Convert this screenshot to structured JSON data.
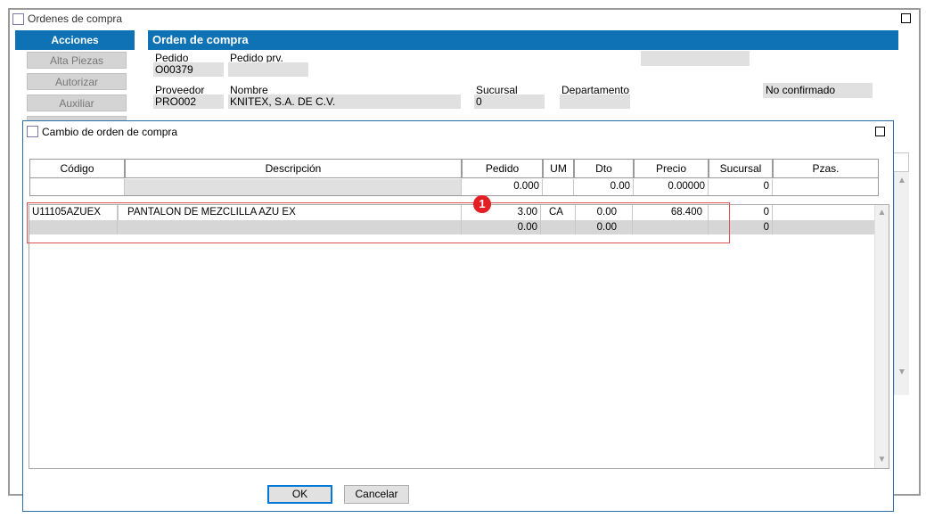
{
  "back_window": {
    "title": "Ordenes de compra",
    "actions_header": "Acciones",
    "side_buttons": [
      "Alta Piezas",
      "Autorizar",
      "Auxiliar"
    ],
    "section_header": "Orden de compra",
    "fields": {
      "pedido_label": "Pedido",
      "pedido_value": "O00379",
      "pedido_prv_label": "Pedido prv.",
      "pedido_prv_value": "",
      "proveedor_label": "Proveedor",
      "proveedor_value": "PRO002",
      "nombre_label": "Nombre",
      "nombre_value": "KNITEX, S.A. DE C.V.",
      "sucursal_label": "Sucursal",
      "sucursal_value": "0",
      "departamento_label": "Departamento",
      "departamento_value": "",
      "status_value": "No confirmado"
    }
  },
  "dialog": {
    "title": "Cambio de orden de compra",
    "columns": [
      "Código",
      "Descripción",
      "Pedido",
      "UM",
      "Dto",
      "Precio",
      "Sucursal",
      "Pzas."
    ],
    "entry_row": {
      "codigo": "",
      "descripcion": "",
      "pedido": "0.000",
      "um": "",
      "dto": "0.00",
      "precio": "0.00000",
      "sucursal": "0",
      "pzas": ""
    },
    "rows": [
      {
        "codigo": "U11105AZUEX",
        "descripcion": "PANTALON DE MEZCLILLA AZU EX",
        "pedido": "3.00",
        "um": "CA",
        "dto": "0.00",
        "precio": "68.400",
        "sucursal": "0",
        "pzas": ""
      },
      {
        "codigo": "",
        "descripcion": "",
        "pedido": "0.00",
        "um": "",
        "dto": "0.00",
        "precio": "",
        "sucursal": "0",
        "pzas": ""
      }
    ],
    "callout_number": "1",
    "ok_label": "OK",
    "cancel_label": "Cancelar"
  },
  "colors": {
    "accent_blue": "#0e72b5",
    "callout_red": "#e31e24",
    "highlight_border": "#e05050"
  }
}
